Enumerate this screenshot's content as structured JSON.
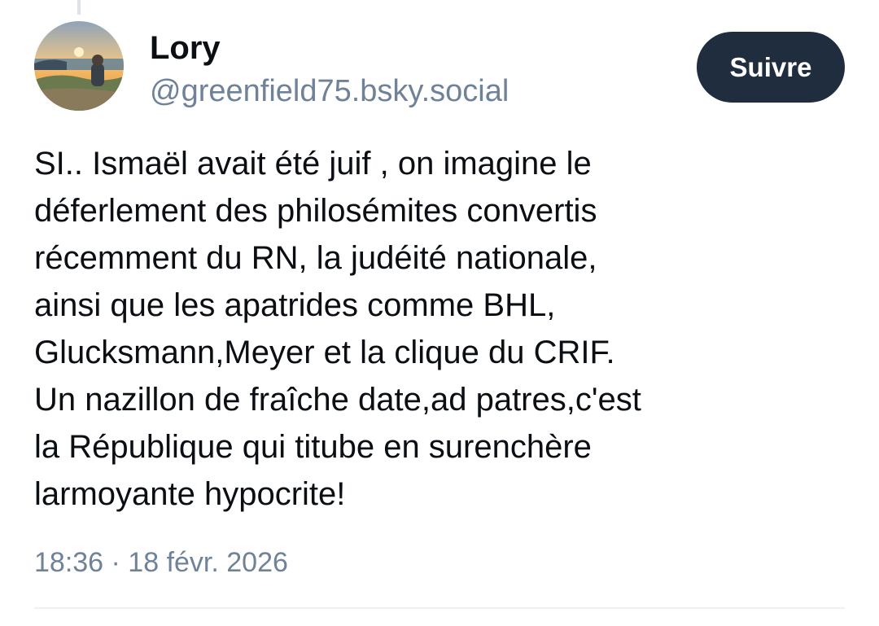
{
  "author": {
    "display_name": "Lory",
    "handle": "@greenfield75.bsky.social"
  },
  "follow_button": {
    "label": "Suivre"
  },
  "post": {
    "lines": [
      "SI.. Ismaël avait été juif , on imagine le",
      "déferlement des philosémites convertis",
      "récemment du RN, la judéité nationale,",
      "ainsi que les apatrides comme BHL,",
      "Glucksmann,Meyer et la clique du CRIF.",
      "Un nazillon de fraîche date,ad patres,c'est",
      "la République qui titube en surenchère",
      "larmoyante hypocrite!"
    ],
    "timestamp": "18:36 · 18 févr. 2026"
  },
  "colors": {
    "follow_button_bg": "#1f2d3f",
    "handle_text": "#6f8297",
    "body_text": "#0b0f14"
  }
}
